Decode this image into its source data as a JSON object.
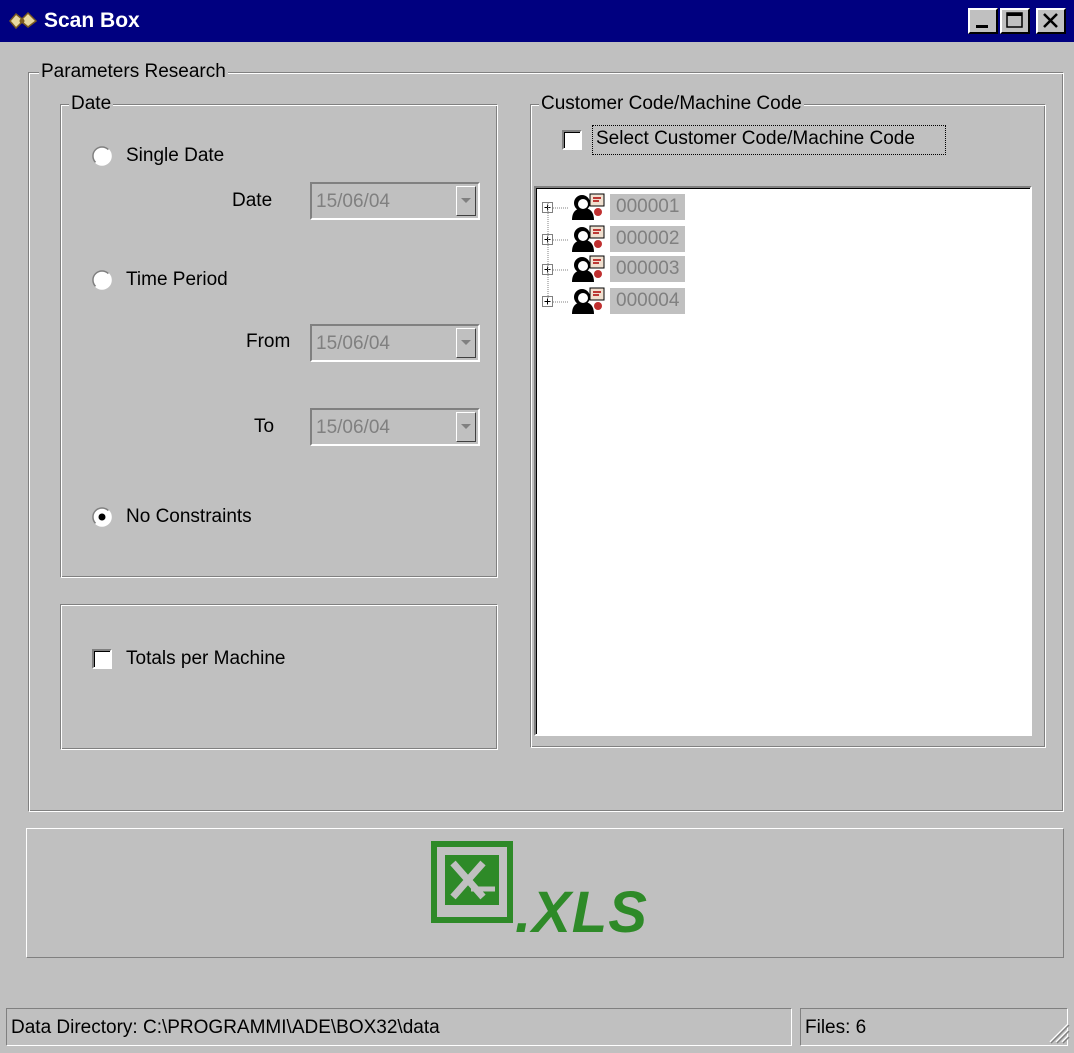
{
  "window": {
    "title": "Scan Box"
  },
  "parameters": {
    "legend": "Parameters Research",
    "date_group": {
      "legend": "Date",
      "single_date_label": "Single Date",
      "date_label": "Date",
      "date_value": "15/06/04",
      "time_period_label": "Time Period",
      "from_label": "From",
      "from_value": "15/06/04",
      "to_label": "To",
      "to_value": "15/06/04",
      "no_constraints_label": "No Constraints",
      "selected_option": "No Constraints"
    },
    "totals_group": {
      "totals_label": "Totals per Machine",
      "totals_checked": false
    },
    "customer_group": {
      "legend": "Customer Code/Machine Code",
      "select_label": "Select Customer Code/Machine Code",
      "select_checked": false,
      "tree_items": [
        "000001",
        "000002",
        "000003",
        "000004"
      ]
    }
  },
  "export": {
    "label": ".XLS",
    "color": "#2e8a28"
  },
  "statusbar": {
    "directory": "Data Directory: C:\\PROGRAMMI\\ADE\\BOX32\\data",
    "files": "Files: 6"
  }
}
